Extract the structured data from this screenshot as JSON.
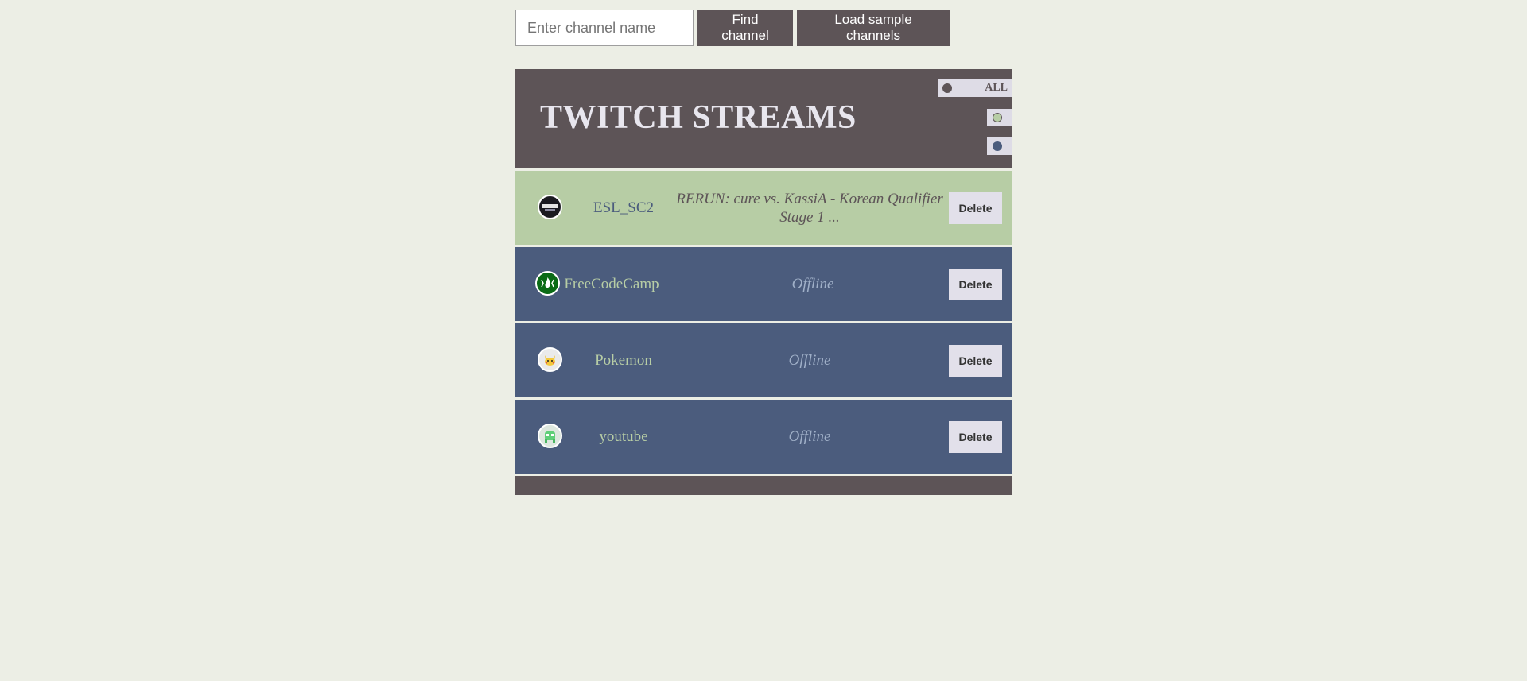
{
  "search": {
    "placeholder": "Enter channel name",
    "value": ""
  },
  "toolbar": {
    "find_label": "Find channel",
    "load_label": "Load sample channels"
  },
  "header": {
    "title": "TWITCH STREAMS"
  },
  "filters": {
    "all_label": "ALL"
  },
  "channels": [
    {
      "name": "ESL_SC2",
      "status": "RERUN: cure vs. KassiA - Korean Qualifier Stage 1 ...",
      "online": true,
      "delete_label": "Delete"
    },
    {
      "name": "FreeCodeCamp",
      "status": "Offline",
      "online": false,
      "delete_label": "Delete"
    },
    {
      "name": "Pokemon",
      "status": "Offline",
      "online": false,
      "delete_label": "Delete"
    },
    {
      "name": "youtube",
      "status": "Offline",
      "online": false,
      "delete_label": "Delete"
    }
  ],
  "colors": {
    "background": "#eceee5",
    "header": "#5d5457",
    "online_row": "#b7cda5",
    "offline_row": "#4b5c7d",
    "button": "#5d5457"
  }
}
